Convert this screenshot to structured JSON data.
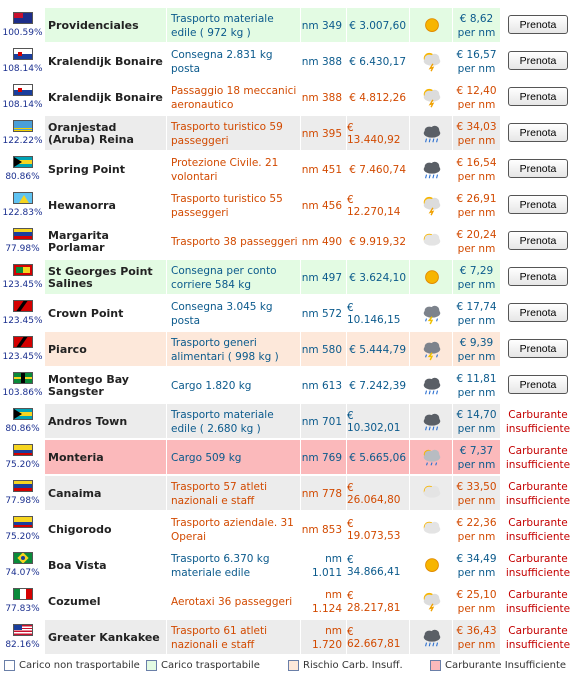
{
  "colors": {
    "white": "#ffffff",
    "green": "#e3fbe3",
    "gray": "#ececec",
    "peach": "#fde8da",
    "pink": "#fbb9bb",
    "blue_text": "#0b5a8c",
    "orange_text": "#d24a00",
    "red_text": "#c40000"
  },
  "rows": [
    {
      "flag": "australia",
      "pct": "100.59%",
      "name": "Providenciales",
      "task": "Trasporto materiale edile ( 972 kg )",
      "task_color": "blue",
      "nm": "nm 349",
      "pay": "€ 3.007,60",
      "pay_color": "blue",
      "weather": "sun",
      "rate": "€ 8,62 per nm",
      "bg": "green",
      "action": "Prenota"
    },
    {
      "flag": "bonaire",
      "pct": "108.14%",
      "name": "Kralendijk Bonaire",
      "task": "Consegna 2.831 kg posta",
      "task_color": "blue",
      "nm": "nm 388",
      "pay": "€ 6.430,17",
      "pay_color": "blue",
      "weather": "storm",
      "rate": "€ 16,57 per nm",
      "bg": "white",
      "action": "Prenota"
    },
    {
      "flag": "bonaire",
      "pct": "108.14%",
      "name": "Kralendijk Bonaire",
      "task": "Passaggio 18 meccanici aeronautico",
      "task_color": "orange",
      "nm": "nm 388",
      "pay": "€ 4.812,26",
      "pay_color": "orange",
      "weather": "storm",
      "rate": "€ 12,40 per nm",
      "bg": "white",
      "action": "Prenota"
    },
    {
      "flag": "aruba",
      "pct": "122.22%",
      "name": "Oranjestad (Aruba) Reina",
      "task": "Trasporto turistico 59 passeggeri",
      "task_color": "orange",
      "nm": "nm 395",
      "pay": "€ 13.440,92",
      "pay_color": "orange",
      "weather": "rain",
      "rate": "€ 34,03 per nm",
      "bg": "gray",
      "action": "Prenota"
    },
    {
      "flag": "bahamas",
      "pct": "80.86%",
      "name": "Spring Point",
      "task": "Protezione Civile. 21 volontari",
      "task_color": "orange",
      "nm": "nm 451",
      "pay": "€ 7.460,74",
      "pay_color": "orange",
      "weather": "rain",
      "rate": "€ 16,54 per nm",
      "bg": "white",
      "action": "Prenota"
    },
    {
      "flag": "stlucia",
      "pct": "122.83%",
      "name": "Hewanorra",
      "task": "Trasporto turistico 55 passeggeri",
      "task_color": "orange",
      "nm": "nm 456",
      "pay": "€ 12.270,14",
      "pay_color": "orange",
      "weather": "storm",
      "rate": "€ 26,91 per nm",
      "bg": "white",
      "action": "Prenota"
    },
    {
      "flag": "venezuela",
      "pct": "77.98%",
      "name": "Margarita Porlamar",
      "task": "Trasporto 38 passeggeri",
      "task_color": "orange",
      "nm": "nm 490",
      "pay": "€ 9.919,32",
      "pay_color": "orange",
      "weather": "partly",
      "rate": "€ 20,24 per nm",
      "bg": "white",
      "action": "Prenota"
    },
    {
      "flag": "grenada",
      "pct": "123.45%",
      "name": "St Georges Point Salines",
      "task": "Consegna per conto corriere 584 kg",
      "task_color": "blue",
      "nm": "nm 497",
      "pay": "€ 3.624,10",
      "pay_color": "blue",
      "weather": "sun",
      "rate": "€ 7,29 per nm",
      "bg": "green",
      "action": "Prenota"
    },
    {
      "flag": "trinidad",
      "pct": "123.45%",
      "name": "Crown Point",
      "task": "Consegna 3.045 kg posta",
      "task_color": "blue",
      "nm": "nm 572",
      "pay": "€ 10.146,15",
      "pay_color": "blue",
      "weather": "thunder",
      "rate": "€ 17,74 per nm",
      "bg": "white",
      "action": "Prenota"
    },
    {
      "flag": "trinidad",
      "pct": "123.45%",
      "name": "Piarco",
      "task": "Trasporto generi alimentari ( 998 kg )",
      "task_color": "blue",
      "nm": "nm 580",
      "pay": "€ 5.444,79",
      "pay_color": "blue",
      "weather": "thunder",
      "rate": "€ 9,39 per nm",
      "bg": "peach",
      "action": "Prenota"
    },
    {
      "flag": "jamaica",
      "pct": "103.86%",
      "name": "Montego Bay Sangster",
      "task": "Cargo 1.820 kg",
      "task_color": "blue",
      "nm": "nm 613",
      "pay": "€ 7.242,39",
      "pay_color": "blue",
      "weather": "rain",
      "rate": "€ 11,81 per nm",
      "bg": "white",
      "action": "Prenota"
    },
    {
      "flag": "bahamas",
      "pct": "80.86%",
      "name": "Andros Town",
      "task": "Trasporto materiale edile ( 2.680 kg )",
      "task_color": "blue",
      "nm": "nm 701",
      "pay": "€ 10.302,01",
      "pay_color": "blue",
      "weather": "rain",
      "rate": "€ 14,70 per nm",
      "bg": "gray",
      "action": "Carburante insufficiente"
    },
    {
      "flag": "colombia",
      "pct": "75.20%",
      "name": "Monteria",
      "task": "Cargo 509 kg",
      "task_color": "blue",
      "nm": "nm 769",
      "pay": "€ 5.665,06",
      "pay_color": "blue",
      "weather": "cloudrain",
      "rate": "€ 7,37 per nm",
      "bg": "pink",
      "action": "Carburante insufficiente"
    },
    {
      "flag": "venezuela",
      "pct": "77.98%",
      "name": "Canaima",
      "task": "Trasporto 57 atleti nazionali e staff",
      "task_color": "orange",
      "nm": "nm 778",
      "pay": "€ 26.064,80",
      "pay_color": "orange",
      "weather": "partly",
      "rate": "€ 33,50 per nm",
      "bg": "gray",
      "action": "Carburante insufficiente"
    },
    {
      "flag": "colombia",
      "pct": "75.20%",
      "name": "Chigorodo",
      "task": "Trasporto aziendale. 31 Operai",
      "task_color": "orange",
      "nm": "nm 853",
      "pay": "€ 19.073,53",
      "pay_color": "orange",
      "weather": "partly",
      "rate": "€ 22,36 per nm",
      "bg": "white",
      "action": "Carburante insufficiente"
    },
    {
      "flag": "brazil",
      "pct": "74.07%",
      "name": "Boa Vista",
      "task": "Trasporto 6.370 kg materiale edile",
      "task_color": "blue",
      "nm": "nm 1.011",
      "pay": "€ 34.866,41",
      "pay_color": "blue",
      "weather": "sun",
      "rate": "€ 34,49 per nm",
      "bg": "white",
      "action": "Carburante insufficiente"
    },
    {
      "flag": "mexico",
      "pct": "77.83%",
      "name": "Cozumel",
      "task": "Aerotaxi 36 passeggeri",
      "task_color": "orange",
      "nm": "nm 1.124",
      "pay": "€ 28.217,81",
      "pay_color": "orange",
      "weather": "storm",
      "rate": "€ 25,10 per nm",
      "bg": "white",
      "action": "Carburante insufficiente"
    },
    {
      "flag": "usa",
      "pct": "82.16%",
      "name": "Greater Kankakee",
      "task": "Trasporto 61 atleti nazionali e staff",
      "task_color": "orange",
      "nm": "nm 1.720",
      "pay": "€ 62.667,81",
      "pay_color": "orange",
      "weather": "rain",
      "rate": "€ 36,43 per nm",
      "bg": "gray",
      "action": "Carburante insufficiente"
    }
  ],
  "legend": [
    {
      "label": "Carico non trasportabile",
      "color": "#ffffff"
    },
    {
      "label": "Carico trasportabile",
      "color": "#e3fbe3"
    },
    {
      "label": "Rischio Carb. Insuff.",
      "color": "#fde8da"
    },
    {
      "label": "Carburante Insufficiente",
      "color": "#fbb9bb"
    }
  ]
}
